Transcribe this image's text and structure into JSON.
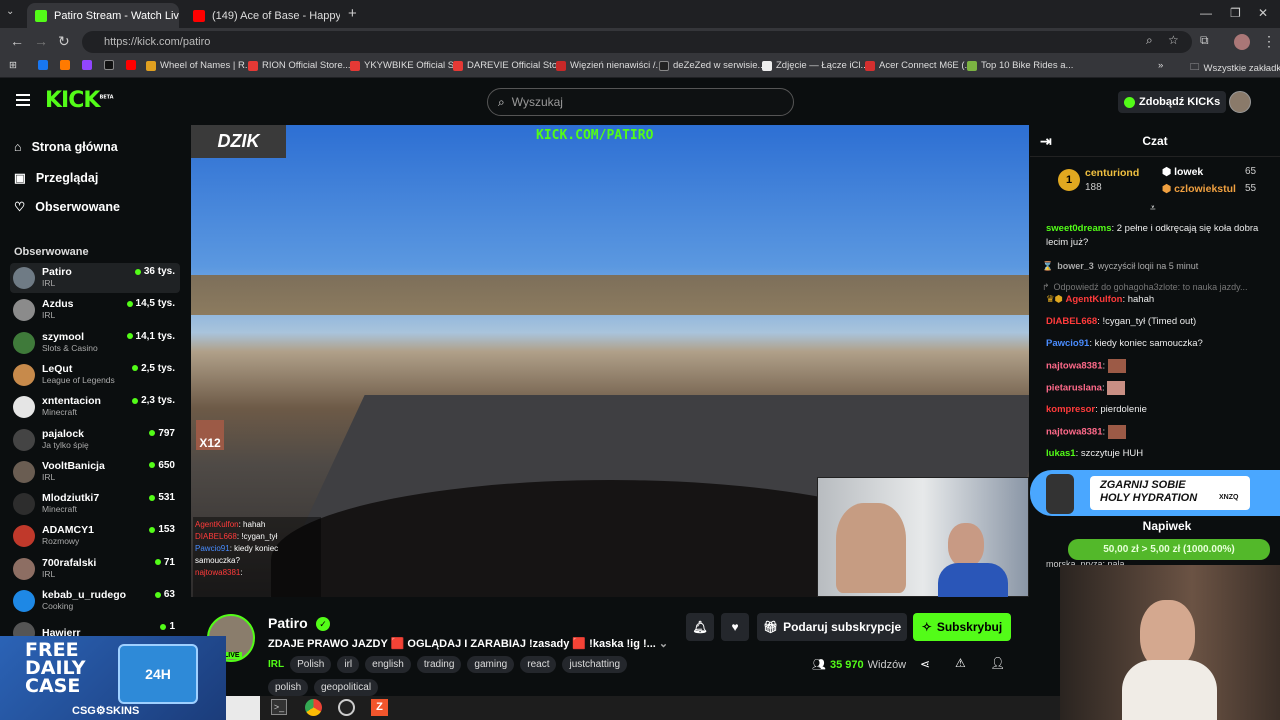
{
  "browser": {
    "tabs": [
      {
        "title": "Patiro Stream - Watch Live on K",
        "favicon_color": "#53fc18"
      },
      {
        "title": "(149) Ace of Base - Happy Natio",
        "favicon_color": "#ff0000"
      }
    ],
    "url": "https://kick.com/patiro",
    "bookmarks": [
      "Wheel of Names | R...",
      "RION Official Store...",
      "YKYWBIKE Official S...",
      "DAREVIE Official Sto...",
      "Więzień nienawiści /...",
      "deZeZed w serwisie...",
      "Zdjęcie — Łącze iCl...",
      "Acer Connect M6E (...",
      "Top 10 Bike Rides a..."
    ],
    "all_bookmarks": "Wszystkie zakładki"
  },
  "header": {
    "logo": "KICK",
    "logo_beta": "BETA",
    "search_placeholder": "Wyszukaj",
    "kicks_button": "Zdobądź KICKs"
  },
  "sidebar": {
    "nav": [
      {
        "label": "Strona główna",
        "icon": "home-icon"
      },
      {
        "label": "Przeglądaj",
        "icon": "browse-icon"
      },
      {
        "label": "Obserwowane",
        "icon": "heart-icon"
      }
    ],
    "followed_title": "Obserwowane",
    "followed": [
      {
        "name": "Patiro",
        "category": "IRL",
        "viewers": "36 tys.",
        "color": "#6f7b85"
      },
      {
        "name": "Azdus",
        "category": "IRL",
        "viewers": "14,5 tys.",
        "color": "#8b8b8b"
      },
      {
        "name": "szymool",
        "category": "Slots & Casino",
        "viewers": "14,1 tys.",
        "color": "#3f7a3a"
      },
      {
        "name": "LeQut",
        "category": "League of Legends",
        "viewers": "2,5 tys.",
        "color": "#c78a4b"
      },
      {
        "name": "xntentacion",
        "category": "Minecraft",
        "viewers": "2,3 tys.",
        "color": "#e5e5e5"
      },
      {
        "name": "pajalock",
        "category": "Ja tylko śpię",
        "viewers": "797",
        "color": "#444"
      },
      {
        "name": "VooltBanicja",
        "category": "IRL",
        "viewers": "650",
        "color": "#6a5d52"
      },
      {
        "name": "Mlodziutki7",
        "category": "Minecraft",
        "viewers": "531",
        "color": "#2d2d2d"
      },
      {
        "name": "ADAMCY1",
        "category": "Rozmowy",
        "viewers": "153",
        "color": "#c0392b"
      },
      {
        "name": "700rafalski",
        "category": "IRL",
        "viewers": "71",
        "color": "#8d6e63"
      },
      {
        "name": "kebab_u_rudego",
        "category": "Cooking",
        "viewers": "63",
        "color": "#1e88e5"
      },
      {
        "name": "Hawierr",
        "category": "",
        "viewers": "1",
        "color": "#555"
      }
    ]
  },
  "video": {
    "brand": "DZIK",
    "overlay_url": "KICK.COM/PATIRO",
    "emote_count": "X12",
    "overlay_chat": [
      {
        "user": "AgentKulfon",
        "text": ": hahah",
        "color": "#ff3b3b"
      },
      {
        "user": "DIABEL668",
        "text": ": !cygan_tył",
        "color": "#ff3b3b"
      },
      {
        "user": "Pawcio91",
        "text": ": kiedy koniec samouczka?",
        "color": "#4a8cff"
      },
      {
        "user": "najtowa8381",
        "text": ":",
        "color": "#ff3b3b"
      }
    ]
  },
  "stream": {
    "channel": "Patiro",
    "live": "LIVE",
    "title": "ZDAJE PRAWO JAZDY 🟥 OGLĄDAJ I ZARABIAJ !zasady 🟥 !kaska !ig !...",
    "category": "IRL",
    "tags": [
      "Polish",
      "irl",
      "english",
      "trading",
      "gaming",
      "react",
      "justchatting"
    ],
    "tags_row2": [
      "polish",
      "geopolitical"
    ],
    "gift_sub": "Podaruj subskrypcje",
    "subscribe": "Subskrybuj",
    "viewers": "35 970",
    "viewers_label": "Widzów"
  },
  "chat": {
    "title": "Czat",
    "leaders": [
      {
        "name": "centuriond",
        "value": "188"
      },
      {
        "name": "lowek",
        "value": "65"
      },
      {
        "name": "czlowiekstul",
        "value": "55"
      }
    ],
    "messages": [
      {
        "user": "sweet0dreams",
        "text": ": 2 pełne i odkręcają się koła dobra lecim już?",
        "color": "#53fc18"
      },
      {
        "user": "bower_3",
        "text": "wyczyścił loqii na 5 minut",
        "color": "#aaa",
        "system": true
      },
      {
        "user": "",
        "text": "Odpowiedź do gohagoha3zlote: to nauka jazdy...",
        "color": "#777",
        "system": true
      },
      {
        "user": "AgentKulfon",
        "text": ": hahah",
        "color": "#ff3b3b"
      },
      {
        "user": "DIABEL668",
        "text": ": !cygan_tył (Timed out)",
        "color": "#ff3b3b"
      },
      {
        "user": "Pawcio91",
        "text": ": kiedy koniec samouczka?",
        "color": "#4a8cff"
      },
      {
        "user": "najtowa8381",
        "text": ":",
        "color": "#ff6a8a"
      },
      {
        "user": "pietaruslana",
        "text": ":",
        "color": "#ff6a8a"
      },
      {
        "user": "kompresor",
        "text": ": pierdolenie",
        "color": "#ff3b3b"
      },
      {
        "user": "najtowa8381",
        "text": ":",
        "color": "#ff6a8a"
      },
      {
        "user": "lukas1",
        "text": ": szczytuje HUH",
        "color": "#53fc18"
      }
    ],
    "promo_line1": "ZGARNIJ SOBIE",
    "promo_line2": "HOLY HYDRATION",
    "promo_code": "XNZQ",
    "tip_title": "Napiwek",
    "tip_progress": "50,00 zł > 5,00 zł (1000.00%)",
    "last_user": "morska_pryza: nala"
  },
  "ad": {
    "line1": "FREE",
    "line2": "DAILY",
    "line3": "CASE",
    "brand": "CSG⚙SKINS",
    "badge": "24H"
  }
}
